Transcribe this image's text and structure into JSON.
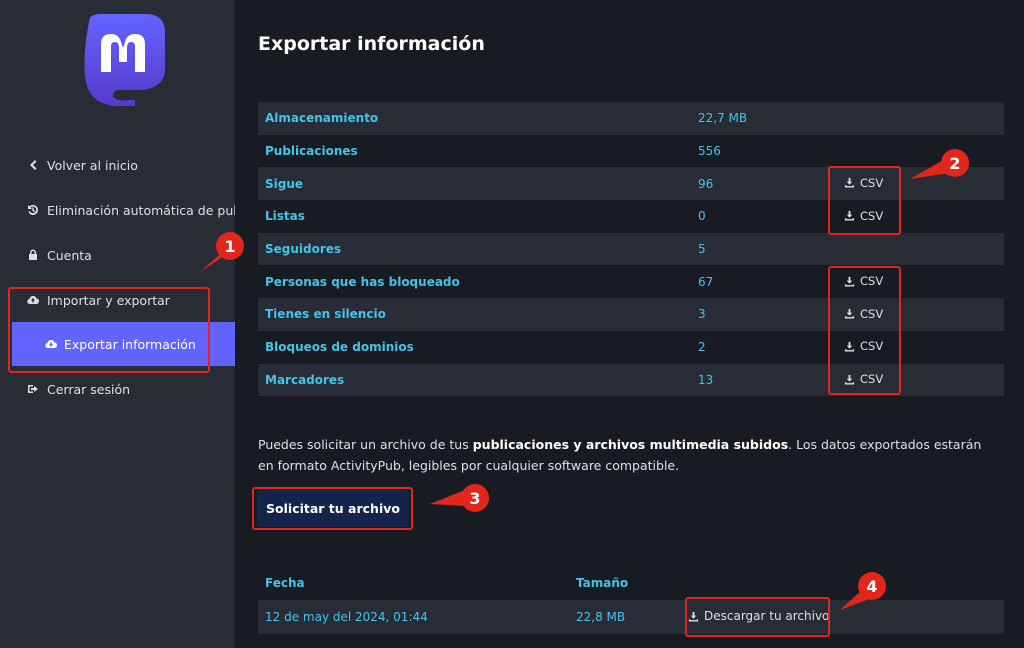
{
  "sidebar": {
    "items": [
      {
        "label": "Volver al inicio",
        "icon": "chevron-left-icon"
      },
      {
        "label": "Eliminación automática de pub…",
        "icon": "history-icon"
      },
      {
        "label": "Cuenta",
        "icon": "lock-icon"
      },
      {
        "label": "Importar y exportar",
        "icon": "cloud-upload-icon"
      },
      {
        "label": "Cerrar sesión",
        "icon": "sign-out-icon"
      }
    ],
    "active_sub": {
      "label": "Exportar información",
      "icon": "cloud-download-icon"
    }
  },
  "main": {
    "title": "Exportar información",
    "stats": [
      {
        "label": "Almacenamiento",
        "value": "22,7 MB",
        "csv": ""
      },
      {
        "label": "Publicaciones",
        "value": "556",
        "csv": ""
      },
      {
        "label": "Sigue",
        "value": "96",
        "csv": "CSV"
      },
      {
        "label": "Listas",
        "value": "0",
        "csv": "CSV"
      },
      {
        "label": "Seguidores",
        "value": "5",
        "csv": ""
      },
      {
        "label": "Personas que has bloqueado",
        "value": "67",
        "csv": "CSV"
      },
      {
        "label": "Tienes en silencio",
        "value": "3",
        "csv": "CSV"
      },
      {
        "label": "Bloqueos de dominios",
        "value": "2",
        "csv": "CSV"
      },
      {
        "label": "Marcadores",
        "value": "13",
        "csv": "CSV"
      }
    ],
    "description": {
      "prefix": "Puedes solicitar un archivo de tus ",
      "bold": "publicaciones y archivos multimedia subidos",
      "suffix": ". Los datos exportados estarán en formato ActivityPub, legibles por cualquier software compatible."
    },
    "request_button": "Solicitar tu archivo",
    "archive": {
      "headers": {
        "date": "Fecha",
        "size": "Tamaño"
      },
      "rows": [
        {
          "date": "12 de may del 2024, 01:44",
          "size": "22,8 MB",
          "download": "Descargar tu archivo"
        }
      ]
    }
  },
  "annotations": [
    "1",
    "2",
    "3",
    "4"
  ],
  "colors": {
    "accent": "#6364ff",
    "link": "#45c3e8",
    "sidebar_bg": "#282c37",
    "page_bg": "#191b22",
    "annotation_red": "#e1261c"
  }
}
